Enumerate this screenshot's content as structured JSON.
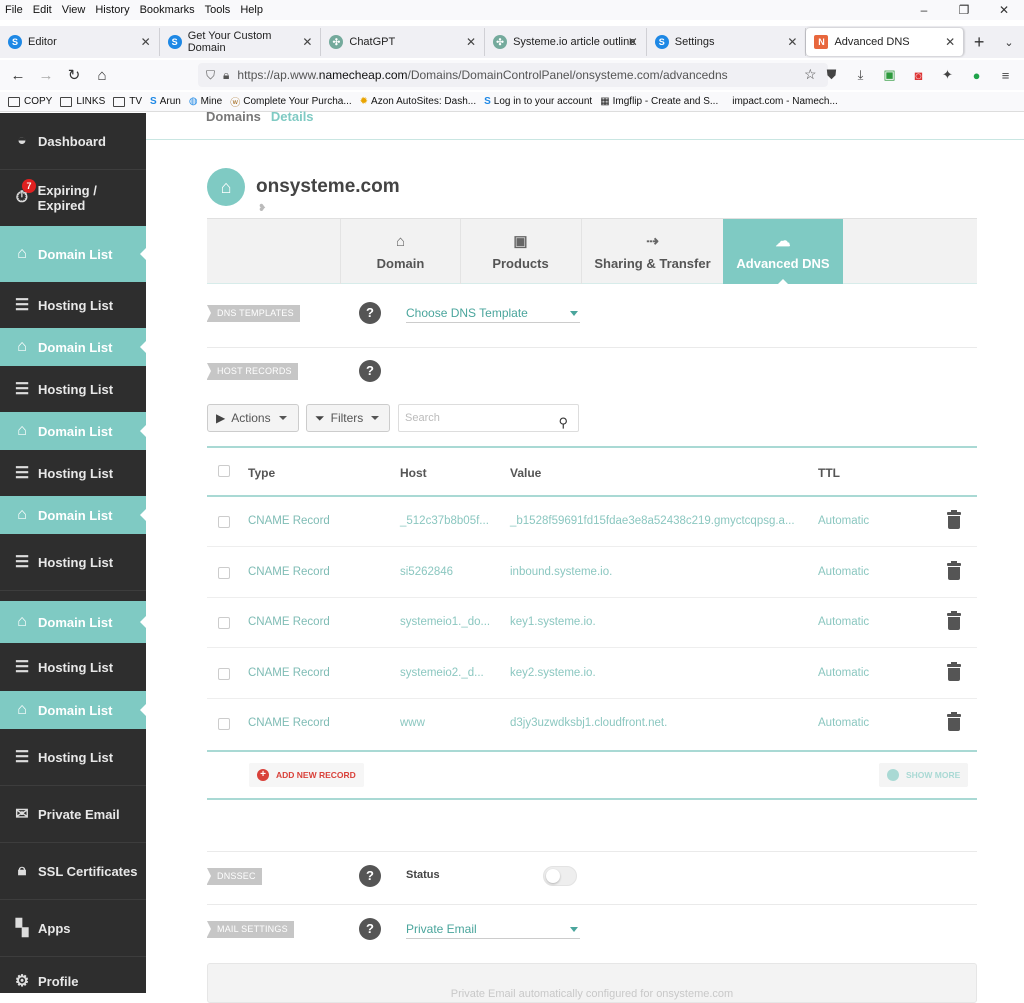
{
  "menubar": {
    "items": [
      "File",
      "Edit",
      "View",
      "History",
      "Bookmarks",
      "Tools",
      "Help"
    ],
    "window_controls": [
      "–",
      "❐",
      "✕"
    ]
  },
  "tabs": [
    {
      "label": "Editor",
      "icon": "s-icon",
      "color": "#1e88e5"
    },
    {
      "label": "Get Your Custom Domain",
      "icon": "s-icon",
      "color": "#1e88e5"
    },
    {
      "label": "ChatGPT",
      "icon": "chatgpt-icon",
      "color": "#74aa9c"
    },
    {
      "label": "Systeme.io article outline",
      "icon": "chatgpt-icon",
      "color": "#74aa9c"
    },
    {
      "label": "Settings",
      "icon": "s-icon",
      "color": "#1e88e5"
    },
    {
      "label": "Advanced DNS",
      "icon": "namecheap-icon",
      "color": "#e8673d"
    }
  ],
  "address": {
    "prefix": "https://ap.www.",
    "host": "namecheap.com",
    "path": "/Domains/DomainControlPanel/onsysteme.com/advancedns"
  },
  "bookmarks": [
    "COPY",
    "LINKS",
    "TV",
    "Arun",
    "Mine",
    "Complete Your Purcha...",
    "Azon AutoSites: Dash...",
    "Log in to your account",
    "Imgflip - Create and S...",
    "impact.com - Namech..."
  ],
  "sidebar": {
    "dashboard": "Dashboard",
    "expiring": "Expiring / Expired",
    "expiring_badge": "7",
    "domain_list": "Domain List",
    "hosting_list": "Hosting List",
    "private_email": "Private Email",
    "ssl": "SSL Certificates",
    "apps": "Apps",
    "profile": "Profile"
  },
  "breadcrumb": {
    "first": "Domains",
    "second": "Details"
  },
  "domain": {
    "name": "onsysteme.com"
  },
  "domain_tabs": [
    "Domain",
    "Products",
    "Sharing & Transfer",
    "Advanced DNS"
  ],
  "dns_templates": {
    "label": "DNS TEMPLATES",
    "select": "Choose DNS Template"
  },
  "host_records": {
    "label": "HOST RECORDS",
    "actions": "Actions",
    "filters": "Filters",
    "search_placeholder": "Search",
    "columns": {
      "type": "Type",
      "host": "Host",
      "value": "Value",
      "ttl": "TTL"
    },
    "rows": [
      {
        "type": "CNAME Record",
        "host": "_512c37b8b05f...",
        "value": "_b1528f59691fd15fdae3e8a52438c219.gmyctcqpsg.a...",
        "ttl": "Automatic"
      },
      {
        "type": "CNAME Record",
        "host": "si5262846",
        "value": "inbound.systeme.io.",
        "ttl": "Automatic"
      },
      {
        "type": "CNAME Record",
        "host": "systemeio1._do...",
        "value": "key1.systeme.io.",
        "ttl": "Automatic"
      },
      {
        "type": "CNAME Record",
        "host": "systemeio2._d...",
        "value": "key2.systeme.io.",
        "ttl": "Automatic"
      },
      {
        "type": "CNAME Record",
        "host": "www",
        "value": "d3jy3uzwdksbj1.cloudfront.net.",
        "ttl": "Automatic"
      }
    ],
    "add_new": "ADD NEW RECORD",
    "show_more": "SHOW MORE"
  },
  "dnssec": {
    "label": "DNSSEC",
    "status_label": "Status",
    "enabled": false
  },
  "mail_settings": {
    "label": "MAIL SETTINGS",
    "select": "Private Email"
  },
  "info_text": "Private Email automatically configured for onsysteme.com",
  "colors": {
    "accent": "#7fcac3",
    "sidebar": "#2e2e2e",
    "danger": "#d9413a"
  }
}
